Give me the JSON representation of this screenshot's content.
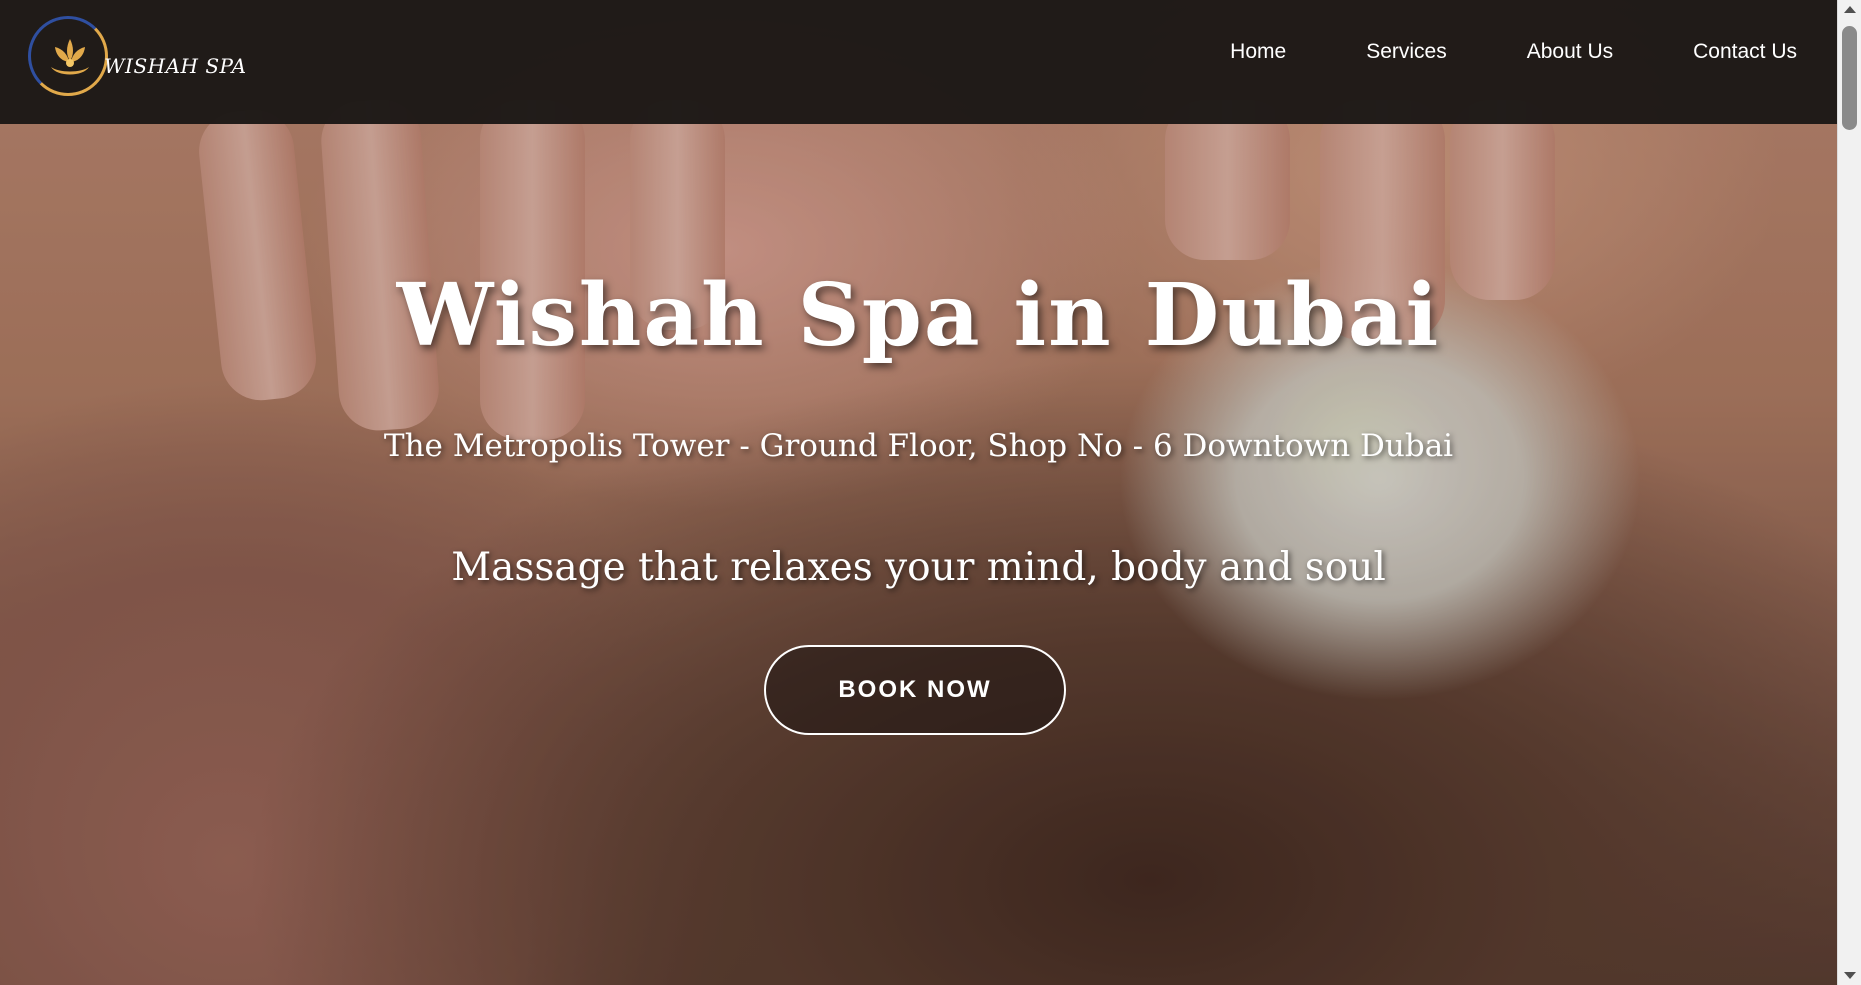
{
  "brand": {
    "logo_text": "WISHAH SPA",
    "accent_color": "#e1a94a"
  },
  "nav": {
    "items": [
      {
        "label": "Home"
      },
      {
        "label": "Services"
      },
      {
        "label": "About Us"
      },
      {
        "label": "Contact Us"
      }
    ]
  },
  "hero": {
    "title": "Wishah Spa in Dubai",
    "address": "The Metropolis Tower - Ground Floor, Shop No - 6 Downtown Dubai",
    "tagline": "Massage that relaxes your mind, body and soul",
    "cta_label": "BOOK NOW",
    "background_image": "massage-hero-photo"
  },
  "icons": {
    "logo": "lotus-icon",
    "scroll_up": "scroll-up-arrow-icon",
    "scroll_down": "scroll-down-arrow-icon"
  }
}
